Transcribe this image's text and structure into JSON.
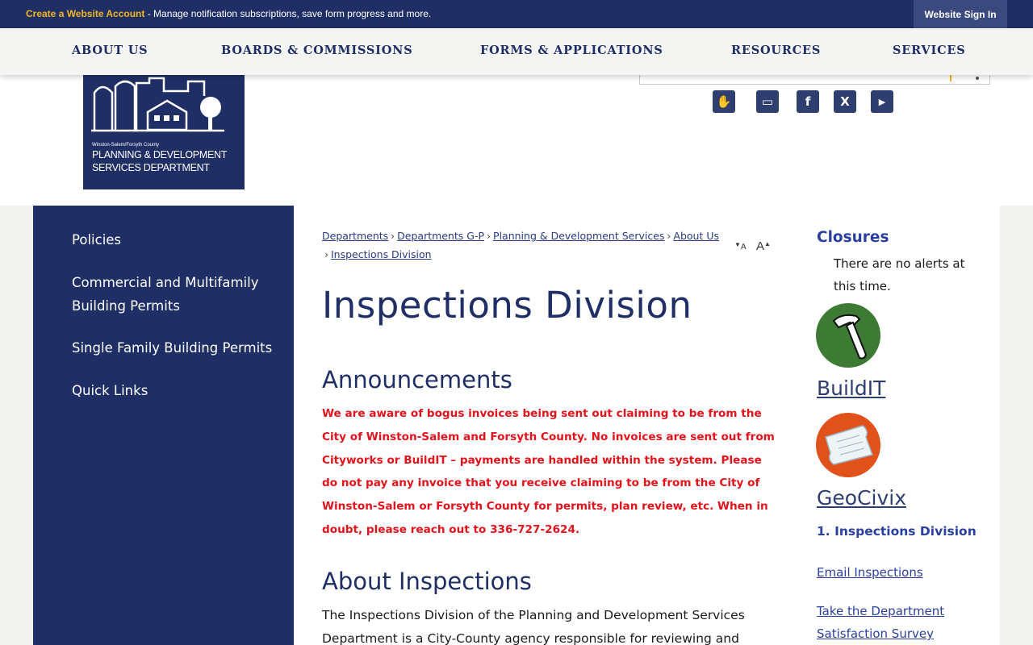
{
  "topbar": {
    "promo_link": "Create a Website Account",
    "promo_text": " - Manage notification subscriptions, save form progress and more.",
    "signin": "Website Sign In"
  },
  "nav": {
    "items": [
      "ABOUT US",
      "BOARDS & COMMISSIONS",
      "FORMS & APPLICATIONS",
      "RESOURCES",
      "SERVICES"
    ]
  },
  "logo": {
    "small": "Winston-Salem/Forsyth County",
    "line1": "PLANNING & DEVELOPMENT",
    "line2": "SERVICES DEPARTMENT"
  },
  "social": {
    "icons": [
      "notify-me-icon",
      "news-icon",
      "facebook-icon",
      "x-twitter-icon",
      "youtube-icon"
    ],
    "glyphs": [
      "✋",
      "▭",
      "f",
      "X",
      "▶"
    ]
  },
  "sidebar": {
    "items": [
      "Policies",
      "Commercial and Multifamily Building Permits",
      "Single Family Building Permits",
      "Quick Links"
    ]
  },
  "breadcrumbs": {
    "items": [
      "Departments",
      "Departments G-P",
      "Planning & Development Services",
      "About Us",
      "Inspections Division"
    ],
    "separator": "›"
  },
  "text_resize": {
    "decrease": "A",
    "increase": "A"
  },
  "page": {
    "title": "Inspections Division",
    "announcements_heading": "Announcements",
    "announcement": "We are aware of bogus invoices being sent out claiming to be from the City of Winston-Salem and Forsyth County. No invoices are sent out from Cityworks or BuildIT – payments are handled within the system. Please do not pay any invoice that you receive claiming to be from the City of Winston-Salem or Forsyth County for permits, plan review, etc. When in doubt, please reach out to 336-727-2624.",
    "about_heading": "About Inspections",
    "about_text": "The Inspections Division of the Planning and Development Services Department is a City-County agency responsible for reviewing and"
  },
  "rail": {
    "closures_title": "Closures",
    "closures_text": "There are no alerts at this time.",
    "buildit": "BuildIT",
    "geocivix": "GeoCivix",
    "sub_heading": "1. Inspections Division",
    "email_link": "Email Inspections",
    "survey_link": "Take the Department Satisfaction Survey"
  },
  "colors": {
    "navy": "#1f2f66",
    "gold": "#f2b51c",
    "alert_red": "#e3121b",
    "link_blue": "#2a3f9e",
    "buildit_green": "#3d7a34",
    "geocivix_orange": "#e0521a"
  }
}
